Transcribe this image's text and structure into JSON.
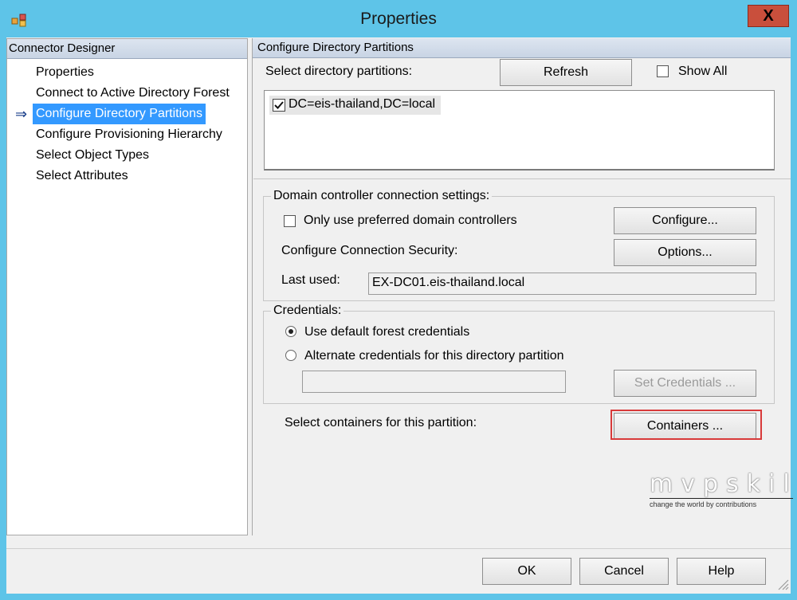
{
  "window": {
    "title": "Properties",
    "close_glyph": "X"
  },
  "left_panel": {
    "header": "Connector Designer",
    "current_indicator": "⇒",
    "items": [
      {
        "label": "Properties"
      },
      {
        "label": "Connect to Active Directory Forest"
      },
      {
        "label": "Configure Directory Partitions"
      },
      {
        "label": "Configure Provisioning Hierarchy"
      },
      {
        "label": "Select Object Types"
      },
      {
        "label": "Select Attributes"
      }
    ]
  },
  "right_panel": {
    "header": "Configure Directory Partitions",
    "select_label": "Select directory partitions:",
    "refresh_button": "Refresh",
    "show_all_label": "Show All",
    "partitions": [
      {
        "label": "DC=eis-thailand,DC=local",
        "checked": true
      }
    ],
    "dc_settings": {
      "legend": "Domain controller connection settings:",
      "preferred_label": "Only use preferred domain controllers",
      "configure_button": "Configure...",
      "security_label": "Configure Connection Security:",
      "options_button": "Options...",
      "last_used_label": "Last used:",
      "last_used_value": "EX-DC01.eis-thailand.local"
    },
    "credentials": {
      "legend": "Credentials:",
      "default_option": "Use default forest credentials",
      "alternate_option": "Alternate credentials for this directory partition",
      "set_credentials_button": "Set Credentials ...",
      "selected": "default"
    },
    "containers_label": "Select containers for this partition:",
    "containers_button": "Containers ..."
  },
  "footer": {
    "ok": "OK",
    "cancel": "Cancel",
    "help": "Help"
  },
  "watermark": {
    "brand": "mvpskill",
    "tagline": "change the world by contributions"
  }
}
